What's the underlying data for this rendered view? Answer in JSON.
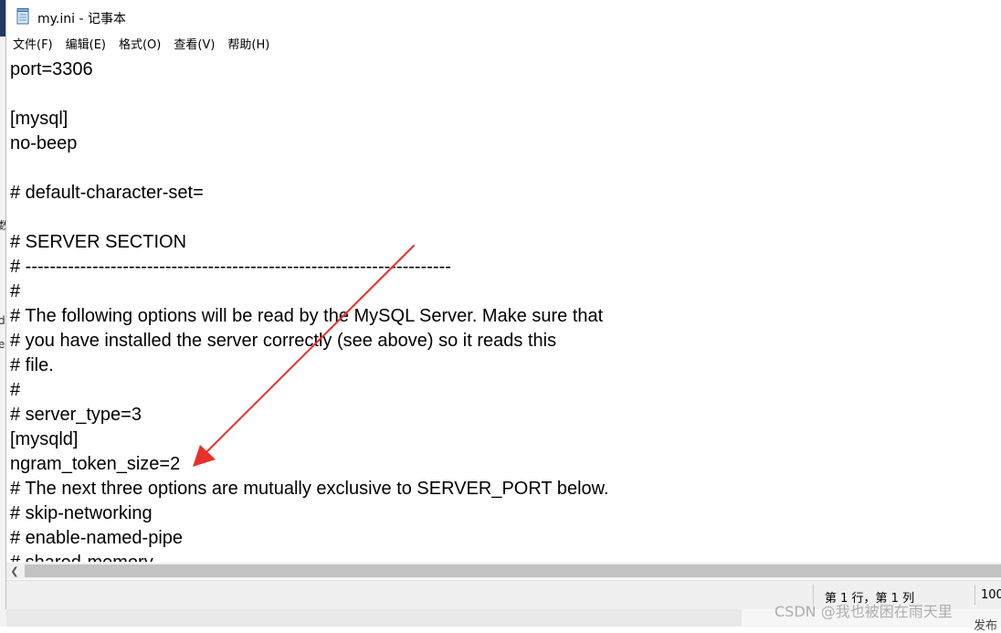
{
  "window": {
    "title": "my.ini - 记事本"
  },
  "menu": {
    "items": [
      "文件(F)",
      "编辑(E)",
      "格式(O)",
      "查看(V)",
      "帮助(H)"
    ]
  },
  "editor": {
    "lines": [
      "port=3306",
      "",
      "[mysql]",
      "no-beep",
      "",
      "# default-character-set=",
      "",
      "# SERVER SECTION",
      "# ----------------------------------------------------------------------",
      "#",
      "# The following options will be read by the MySQL Server. Make sure that",
      "# you have installed the server correctly (see above) so it reads this",
      "# file.",
      "#",
      "# server_type=3",
      "[mysqld]",
      "ngram_token_size=2",
      "# The next three options are mutually exclusive to SERVER_PORT below.",
      "# skip-networking",
      "# enable-named-pipe",
      "# shared-memory"
    ]
  },
  "statusbar": {
    "position": "第 1 行，第 1 列",
    "zoom": "100"
  },
  "watermark": "CSDN @我也被困在雨天里",
  "behind": {
    "left_chars": [
      "数",
      "d",
      "e"
    ],
    "bottom_right_text": "发布"
  },
  "annotation": {
    "arrow_color": "#e8302a"
  },
  "icons": {
    "app": "notepad-icon",
    "scroll_left": "chevron-left-icon"
  }
}
